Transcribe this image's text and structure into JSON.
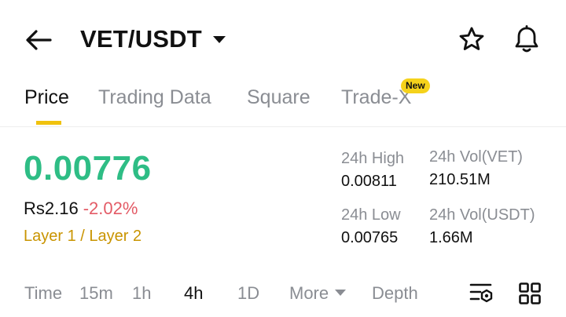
{
  "header": {
    "back_icon": "arrow-left-icon",
    "pair": "VET/USDT",
    "favorite_icon": "star-icon",
    "alert_icon": "bell-icon"
  },
  "tabs": [
    {
      "label": "Price",
      "active": true
    },
    {
      "label": "Trading Data",
      "active": false
    },
    {
      "label": "Square",
      "active": false
    },
    {
      "label": "Trade-X",
      "active": false,
      "badge": "New"
    }
  ],
  "price": {
    "last": "0.00776",
    "fiat": "Rs2.16",
    "change": "-2.02%",
    "category": "Layer 1 / Layer 2"
  },
  "stats": {
    "high_label": "24h High",
    "high_value": "0.00811",
    "vol_base_label": "24h Vol(VET)",
    "vol_base_value": "210.51M",
    "low_label": "24h Low",
    "low_value": "0.00765",
    "vol_quote_label": "24h Vol(USDT)",
    "vol_quote_value": "1.66M"
  },
  "intervals": {
    "time": "Time",
    "m15": "15m",
    "h1": "1h",
    "h4": "4h",
    "d1": "1D",
    "more": "More",
    "depth": "Depth",
    "active": "4h",
    "indicator_icon": "chart-settings-icon",
    "layout_icon": "grid-icon"
  },
  "colors": {
    "up": "#2ebd85",
    "down": "#e35b66",
    "accent": "#f0c20e",
    "category": "#c99400"
  }
}
